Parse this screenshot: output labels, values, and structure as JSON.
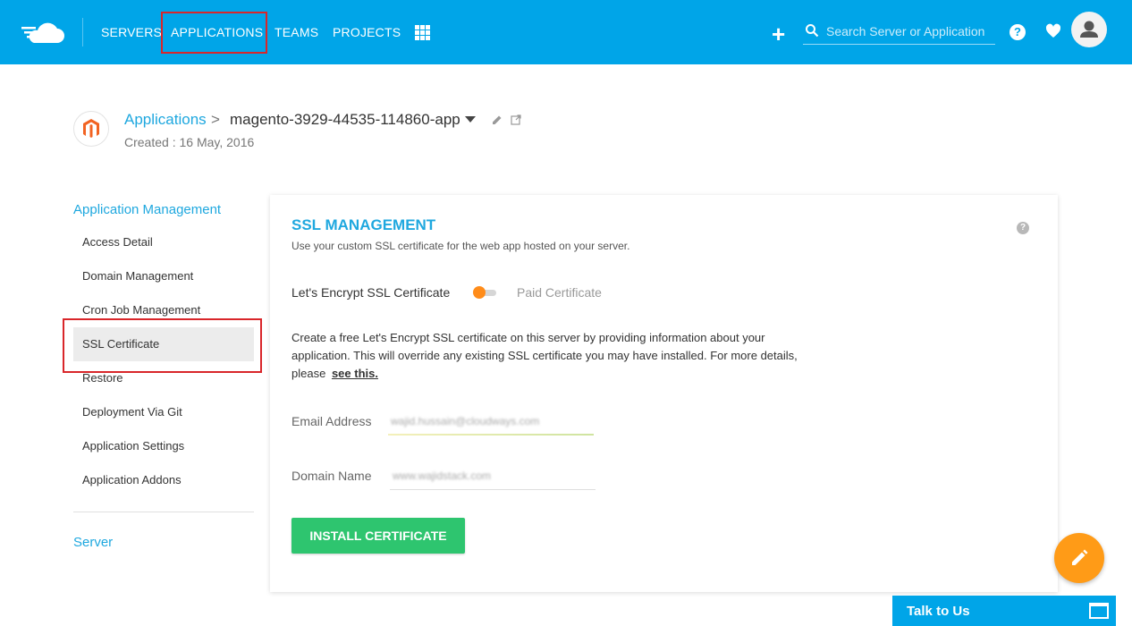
{
  "nav": {
    "items": [
      "SERVERS",
      "APPLICATIONS",
      "TEAMS",
      "PROJECTS"
    ],
    "search_placeholder": "Search Server or Application",
    "help_label": "?"
  },
  "header": {
    "breadcrumb_root": "Applications",
    "breadcrumb_separator": ">",
    "app_name": "magento-3929-44535-114860-app",
    "created": "Created : 16 May, 2016"
  },
  "sidebar": {
    "title": "Application Management",
    "items": [
      "Access Detail",
      "Domain Management",
      "Cron Job Management",
      "SSL Certificate",
      "Restore",
      "Deployment Via Git",
      "Application Settings",
      "Application Addons"
    ],
    "active_item": "SSL Certificate",
    "server_label": "Server"
  },
  "ssl": {
    "title": "SSL MANAGEMENT",
    "subtitle": "Use your custom SSL certificate for the web app hosted on your server.",
    "help_label": "?",
    "toggle_left": "Let's Encrypt SSL Certificate",
    "toggle_right": "Paid Certificate",
    "description": "Create a free Let's Encrypt SSL certificate on this server by providing information about your application. This will override any existing SSL certificate you may have installed. For more details, please",
    "link_text": "see this.",
    "email_label": "Email Address",
    "email_value": "wajid.hussain@cloudways.com",
    "domain_label": "Domain Name",
    "domain_value": "www.wajidstack.com",
    "install_button": "INSTALL CERTIFICATE"
  },
  "chat": {
    "label": "Talk to Us"
  },
  "colors": {
    "brand": "#00a5e8",
    "accent_orange": "#ff9b17",
    "install_green": "#2ec56f",
    "highlight_red": "#d9262a"
  }
}
